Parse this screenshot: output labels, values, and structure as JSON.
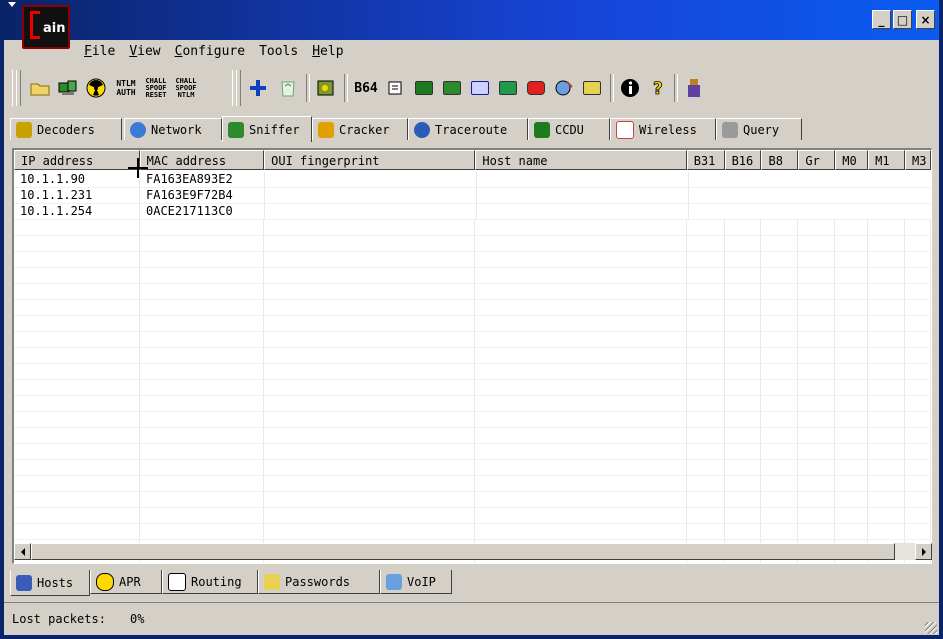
{
  "app": {
    "title": "",
    "logo_text": "ain"
  },
  "window_controls": {
    "minimize": "_",
    "maximize": "□",
    "close": "×"
  },
  "menu": [
    {
      "label": "File",
      "key": "F"
    },
    {
      "label": "View",
      "key": "V"
    },
    {
      "label": "Configure",
      "key": "C"
    },
    {
      "label": "Tools",
      "key": "T"
    },
    {
      "label": "Help",
      "key": "H"
    }
  ],
  "toolbar": {
    "ntlm_auth": "NTLM\nAUTH",
    "chall_spoof_reset": "CHALL\nSPOOF\nRESET",
    "chall_spoof_ntlm": "CHALL\nSPOOF\nNTLM",
    "base64": "B64"
  },
  "top_tabs": [
    {
      "label": "Decoders",
      "icon": "decoders-icon",
      "color": "#c8a200"
    },
    {
      "label": "Network",
      "icon": "network-icon",
      "color": "#3a7bd5"
    },
    {
      "label": "Sniffer",
      "icon": "sniffer-icon",
      "color": "#2d8a2d",
      "active": true
    },
    {
      "label": "Cracker",
      "icon": "cracker-icon",
      "color": "#e0a000"
    },
    {
      "label": "Traceroute",
      "icon": "traceroute-icon",
      "color": "#2a5bb8"
    },
    {
      "label": "CCDU",
      "icon": "ccdu-icon",
      "color": "#1e7a1e"
    },
    {
      "label": "Wireless",
      "icon": "wireless-icon",
      "color": "#d04040"
    },
    {
      "label": "Query",
      "icon": "query-icon",
      "color": "#6c6c6c"
    }
  ],
  "columns": [
    "IP address",
    "MAC address",
    "OUI fingerprint",
    "Host name",
    "B31",
    "B16",
    "B8",
    "Gr",
    "M0",
    "M1",
    "M3"
  ],
  "hosts": [
    {
      "ip": "10.1.1.90",
      "mac": "FA163EA893E2",
      "oui": "",
      "host": ""
    },
    {
      "ip": "10.1.1.231",
      "mac": "FA163E9F72B4",
      "oui": "",
      "host": ""
    },
    {
      "ip": "10.1.1.254",
      "mac": "0ACE217113C0",
      "oui": "",
      "host": ""
    }
  ],
  "bottom_tabs": [
    {
      "label": "Hosts",
      "icon": "hosts-icon",
      "active": true
    },
    {
      "label": "APR",
      "icon": "apr-icon"
    },
    {
      "label": "Routing",
      "icon": "routing-icon"
    },
    {
      "label": "Passwords",
      "icon": "passwords-icon"
    },
    {
      "label": "VoIP",
      "icon": "voip-icon"
    }
  ],
  "status": {
    "label": "Lost packets:",
    "value": "0%"
  },
  "colors": {
    "titlebar": "#0a246a",
    "face": "#d4d0c8"
  }
}
